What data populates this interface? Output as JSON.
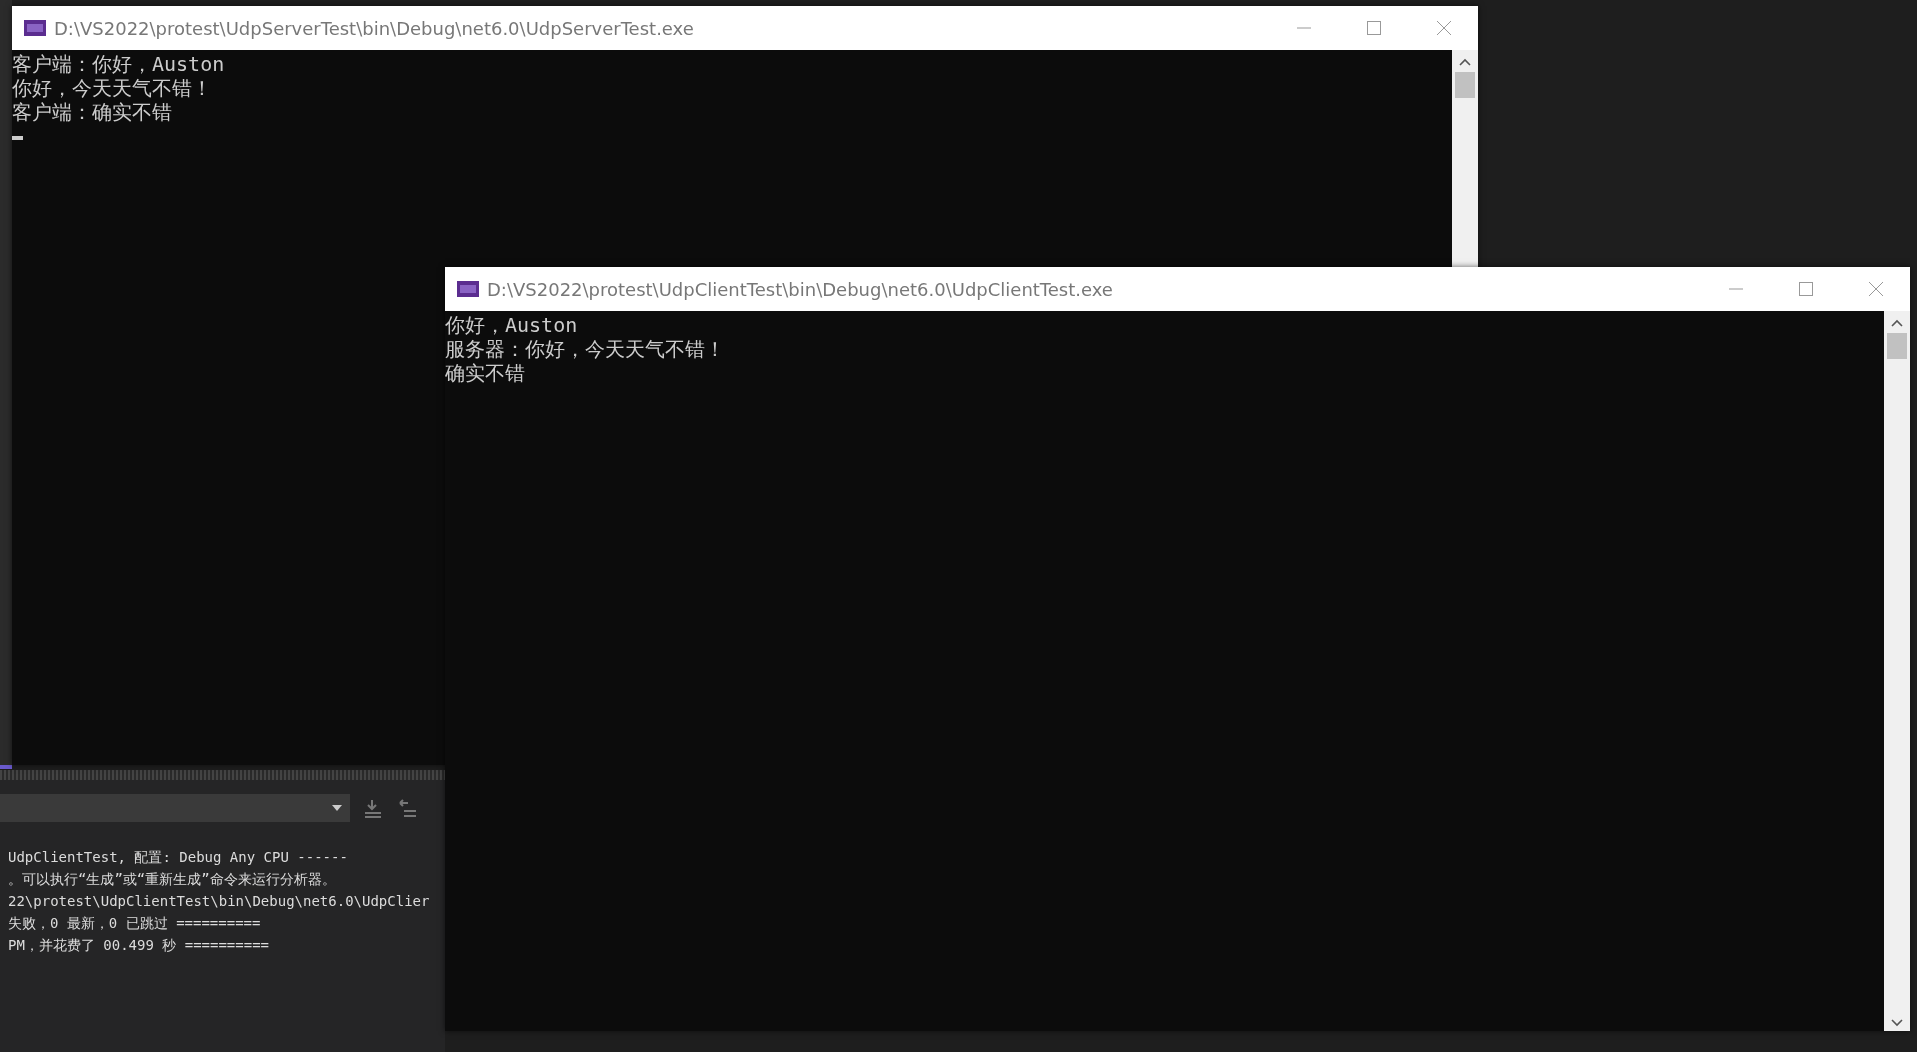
{
  "output_panel": {
    "lines": [
      "UdpClientTest, 配置: Debug Any CPU ------",
      "。可以执行“生成”或“重新生成”命令来运行分析器。",
      "22\\protest\\UdpClientTest\\bin\\Debug\\net6.0\\UdpClier",
      "失败，0 最新，0 已跳过 ==========",
      "PM，并花费了 00.499 秒 =========="
    ]
  },
  "windows": [
    {
      "title": "D:\\VS2022\\protest\\UdpServerTest\\bin\\Debug\\net6.0\\UdpServerTest.exe",
      "lines": [
        "客户端：你好，Auston",
        "你好，今天天气不错！",
        "客户端：确实不错"
      ],
      "cursor": true
    },
    {
      "title": "D:\\VS2022\\protest\\UdpClientTest\\bin\\Debug\\net6.0\\UdpClientTest.exe",
      "lines": [
        "你好，Auston",
        "服务器：你好，今天天气不错！",
        "确实不错"
      ],
      "cursor": false
    }
  ]
}
